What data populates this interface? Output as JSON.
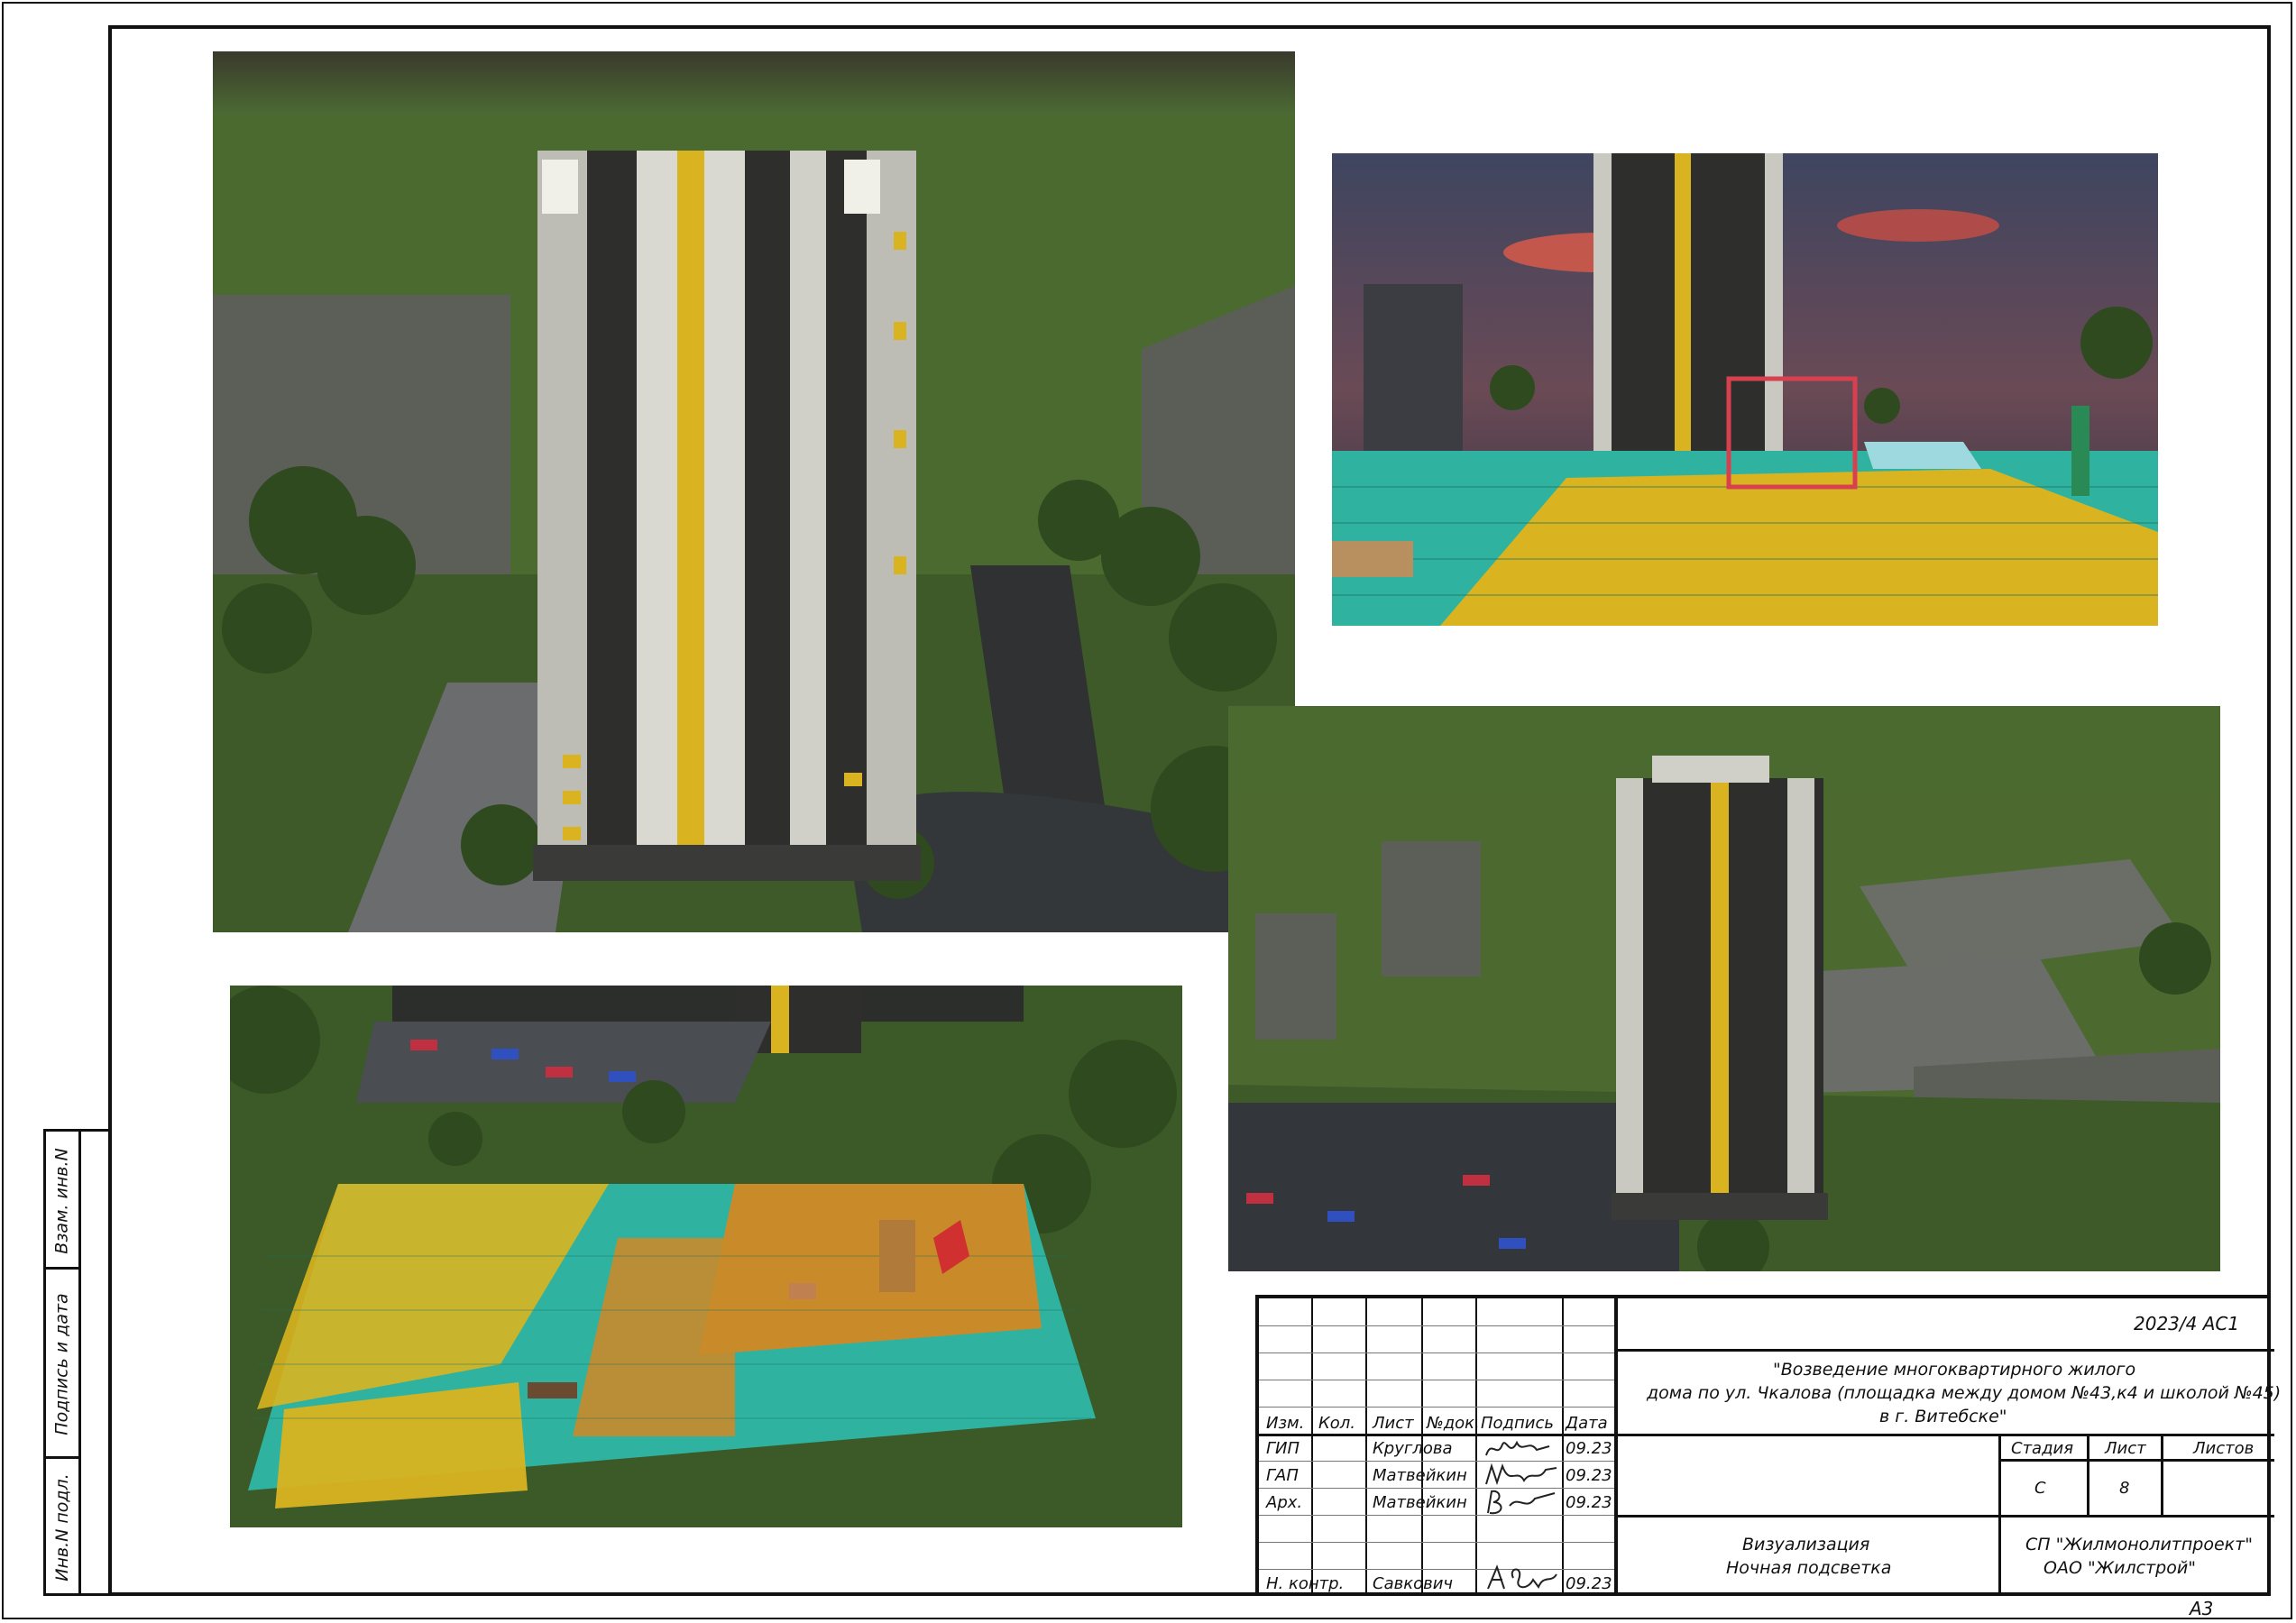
{
  "title_block": {
    "code": "2023/4 АС1",
    "project_title_line1": "\"Возведение многоквартирного жилого",
    "project_title_line2": "дома по ул. Чкалова (площадка между домом №43,к4 и школой №45)",
    "project_title_line3": "в г. Витебске\"",
    "headers": {
      "izm": "Изм.",
      "kol": "Кол.",
      "list": "Лист",
      "ndok": "№док.",
      "podpis": "Подпись",
      "data": "Дата"
    },
    "roles": [
      {
        "role": "ГИП",
        "name": "Круглова",
        "date": "09.23"
      },
      {
        "role": "ГАП",
        "name": "Матвейкин",
        "date": "09.23"
      },
      {
        "role": "Арх.",
        "name": "Матвейкин",
        "date": "09.23"
      },
      {
        "role": "Н. контр.",
        "name": "Савкович",
        "date": "09.23"
      }
    ],
    "stage_header": "Стадия",
    "sheet_header": "Лист",
    "sheets_header": "Листов",
    "stage_value": "С",
    "sheet_value": "8",
    "sheets_value": "",
    "drawing_name_line1": "Визуализация",
    "drawing_name_line2": "Ночная подсветка",
    "org_line1": "СП \"Жилмонолитпроект\"",
    "org_line2": "ОАО \"Жилстрой\""
  },
  "side_stamp": {
    "vzam": "Взам. инв.N",
    "podpis_data": "Подпись и дата",
    "inv_podl": "Инв.N подл."
  },
  "format": "А3",
  "colors": {
    "grass": "#4a6b2e",
    "night_sky": "#2b3320",
    "teal_tile": "#2fb3a0",
    "yellow_tile": "#d9b420",
    "building_white": "#d8d8d0",
    "building_dark": "#2e2f2c"
  },
  "renders": [
    {
      "name": "tower-aerial-view"
    },
    {
      "name": "playground-sunset-view"
    },
    {
      "name": "playground-night-aerial-view"
    },
    {
      "name": "tower-distant-aerial-view"
    }
  ]
}
